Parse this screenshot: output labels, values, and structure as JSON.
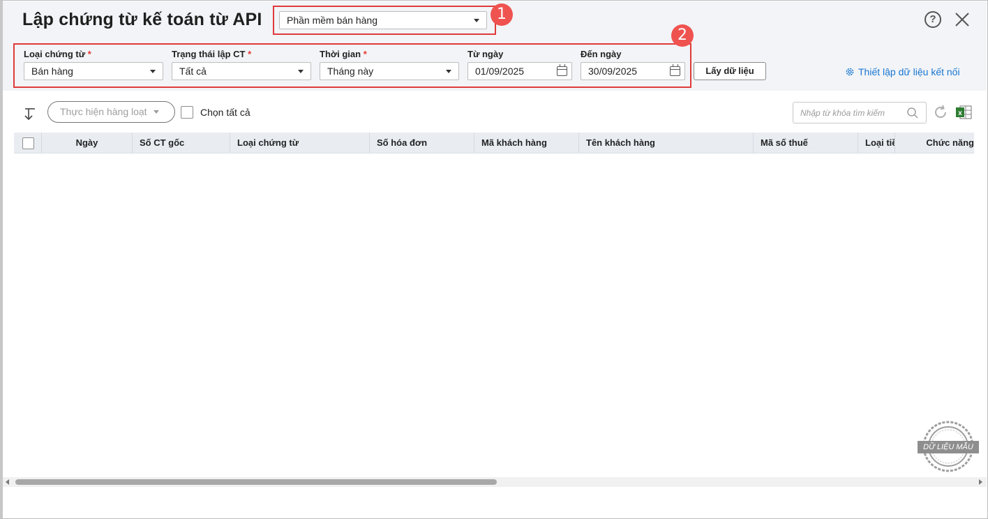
{
  "header": {
    "title": "Lập chứng từ kế toán từ API",
    "source_select": "Phần mềm bán hàng",
    "badge_1": "1",
    "badge_2": "2",
    "help_icon": "?"
  },
  "filters": {
    "voucher_type": {
      "label": "Loại chứng từ",
      "value": "Bán hàng"
    },
    "status": {
      "label": "Trạng thái lập CT",
      "value": "Tất cả"
    },
    "period": {
      "label": "Thời gian",
      "value": "Tháng này"
    },
    "from_date": {
      "label": "Từ ngày",
      "value": "01/09/2025"
    },
    "to_date": {
      "label": "Đến ngày",
      "value": "30/09/2025"
    },
    "required_mark": "*",
    "get_data_button": "Lấy dữ liệu",
    "setup_link": "Thiết lập dữ liệu kết nối"
  },
  "toolbar": {
    "batch_button": "Thực hiện hàng loạt",
    "select_all": "Chọn tất cả",
    "search_placeholder": "Nhập từ khóa tìm kiếm"
  },
  "table": {
    "columns": [
      "Ngày",
      "Số CT gốc",
      "Loại chứng từ",
      "Số hóa đơn",
      "Mã khách hàng",
      "Tên khách hàng",
      "Mã số thuế",
      "Loại tiề",
      "Chức năng"
    ],
    "rows": []
  },
  "watermark": "DỮ LIỆU MẪU",
  "colors": {
    "annotation_red": "#e03a3a",
    "badge_red": "#ef5350",
    "link_blue": "#1976d2",
    "header_bg": "#f2f4f7",
    "table_header_bg": "#e9edf2"
  }
}
